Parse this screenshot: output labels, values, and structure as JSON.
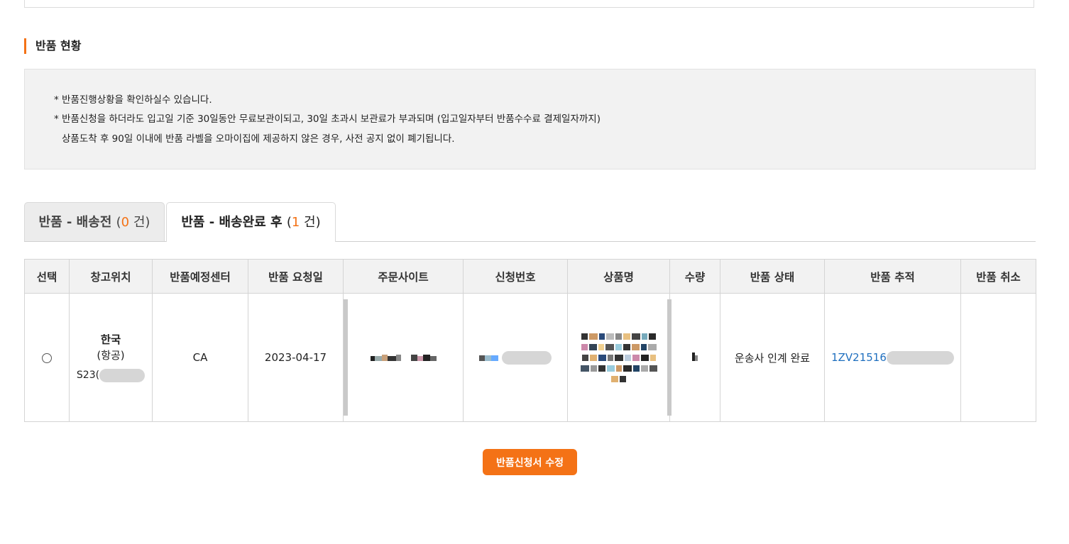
{
  "section": {
    "title": "반품 현황"
  },
  "notice": {
    "line1": "* 반품진행상황을 확인하실수 있습니다.",
    "line2": "* 반품신청을 하더라도 입고일 기준 30일동안 무료보관이되고, 30일 초과시 보관료가 부과되며 (입고일자부터 반품수수료 결제일자까지)",
    "line3": "상품도착 후 90일 이내에 반품 라벨을 오마이집에 제공하지 않은 경우, 사전 공지 없이 폐기됩니다."
  },
  "tabs": [
    {
      "label": "반품 - 배송전",
      "open": "(",
      "count": "0",
      "unit": "건)",
      "active": false
    },
    {
      "label": "반품 - 배송완료 후",
      "open": "(",
      "count": "1",
      "unit": "건)",
      "active": true
    }
  ],
  "table": {
    "headers": [
      "선택",
      "창고위치",
      "반품예정센터",
      "반품 요청일",
      "주문사이트",
      "신청번호",
      "상품명",
      "수량",
      "반품 상태",
      "반품 추적",
      "반품 취소"
    ],
    "row": {
      "warehouse": "한국",
      "warehouse_sub": "(항공)",
      "warehouse_code": "S23(",
      "center": "CA",
      "request_date": "2023-04-17",
      "status": "운송사 인계 완료",
      "tracking": "1ZV21516",
      "cancel": ""
    }
  },
  "button": {
    "modify": "반품신청서 수정"
  },
  "colors": {
    "accent": "#f47216",
    "link": "#1f6fbf"
  }
}
